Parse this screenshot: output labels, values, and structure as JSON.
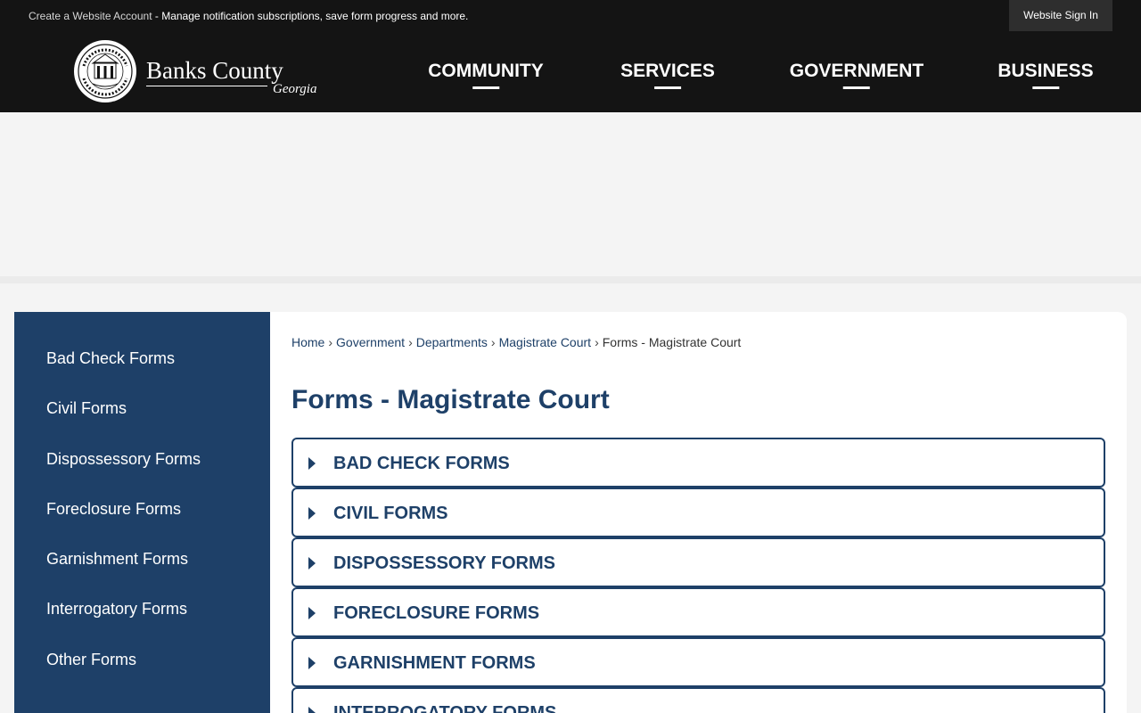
{
  "topbar": {
    "account_link": "Create a Website Account",
    "separator": " - ",
    "message": "Manage notification subscriptions, save form progress and more.",
    "signin_label": "Website Sign In"
  },
  "logo": {
    "name": "Banks County",
    "state": "Georgia",
    "seal_text": "BANKS COUNTY · ESTABLISHED 1858"
  },
  "nav": {
    "items": [
      {
        "label": "COMMUNITY"
      },
      {
        "label": "SERVICES"
      },
      {
        "label": "GOVERNMENT"
      },
      {
        "label": "BUSINESS"
      }
    ]
  },
  "sidebar": {
    "items": [
      {
        "label": "Bad Check Forms"
      },
      {
        "label": "Civil Forms"
      },
      {
        "label": "Dispossessory Forms"
      },
      {
        "label": "Foreclosure Forms"
      },
      {
        "label": "Garnishment Forms"
      },
      {
        "label": "Interrogatory Forms"
      },
      {
        "label": "Other Forms"
      }
    ]
  },
  "breadcrumb": {
    "separator": "›",
    "links": [
      "Home",
      "Government",
      "Departments",
      "Magistrate Court"
    ],
    "current": "Forms - Magistrate Court"
  },
  "page": {
    "title": "Forms - Magistrate Court"
  },
  "accordion": {
    "items": [
      {
        "label": "BAD CHECK FORMS"
      },
      {
        "label": "CIVIL FORMS"
      },
      {
        "label": "DISPOSSESSORY FORMS"
      },
      {
        "label": "FORECLOSURE FORMS"
      },
      {
        "label": "GARNISHMENT FORMS"
      },
      {
        "label": "INTERROGATORY FORMS"
      }
    ]
  },
  "colors": {
    "header_bg": "#141414",
    "brand_blue": "#1e4068",
    "page_bg": "#f4f4f4"
  }
}
